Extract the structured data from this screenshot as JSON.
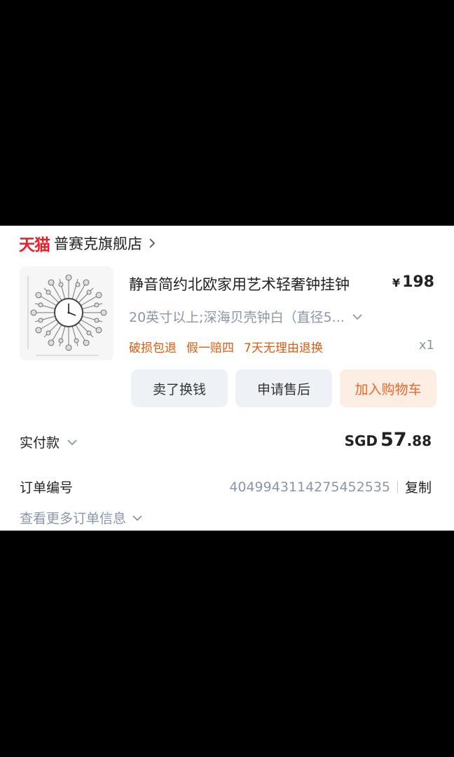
{
  "store": {
    "brand": "天猫",
    "name": "普赛克旗舰店"
  },
  "product": {
    "title": "静音简约北欧家用艺术轻奢钟挂钟",
    "price_symbol": "¥",
    "price": "198",
    "variant": "20英寸以上;深海贝壳钟白（直径5...",
    "guarantees": [
      "破损包退",
      "假一赔四",
      "7天无理由退换"
    ],
    "quantity": "x1"
  },
  "actions": {
    "resell_label": "卖了换钱",
    "after_sale_label": "申请售后",
    "add_cart_label": "加入购物车"
  },
  "payment": {
    "label": "实付款",
    "currency": "SGD",
    "amount_int": "57",
    "amount_dec": ".88"
  },
  "order": {
    "label": "订单编号",
    "number": "4049943114275452535",
    "copy_label": "复制"
  },
  "more": {
    "label": "查看更多订单信息"
  },
  "colors": {
    "brand_red": "#e8202a",
    "accent_orange": "#e05a10",
    "muted_text": "#8a96a8"
  }
}
